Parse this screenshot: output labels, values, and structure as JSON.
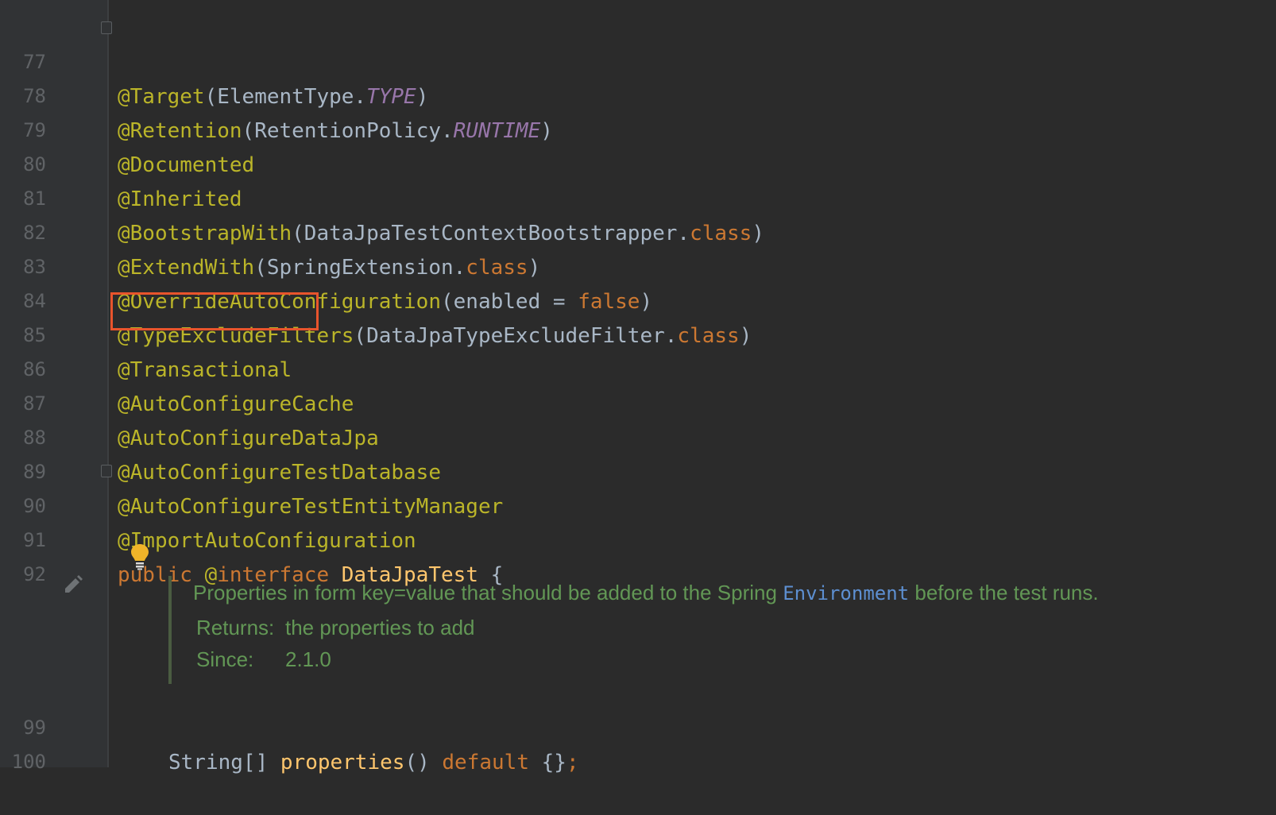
{
  "editor": {
    "lines": [
      {
        "num": "77",
        "a": "@Target",
        "b": "(ElementType.",
        "c": "TYPE",
        "d": ")"
      },
      {
        "num": "78",
        "a": "@Retention",
        "b": "(RetentionPolicy.",
        "c": "RUNTIME",
        "d": ")"
      },
      {
        "num": "79",
        "a": "@Documented"
      },
      {
        "num": "80",
        "a": "@Inherited"
      },
      {
        "num": "81",
        "a": "@BootstrapWith",
        "b": "(DataJpaTestContextBootstrapper.",
        "c": "class",
        "d": ")"
      },
      {
        "num": "82",
        "a": "@ExtendWith",
        "b": "(SpringExtension.",
        "c": "class",
        "d": ")"
      },
      {
        "num": "83",
        "a": "@OverrideAutoConfiguration",
        "b": "(enabled = ",
        "c": "false",
        "d": ")"
      },
      {
        "num": "84",
        "a": "@TypeExcludeFilters",
        "b": "(DataJpaTypeExcludeFilter.",
        "c": "class",
        "d": ")"
      },
      {
        "num": "85",
        "a": "@Transactional"
      },
      {
        "num": "86",
        "a": "@AutoConfigureCache"
      },
      {
        "num": "87",
        "a": "@AutoConfigureDataJpa"
      },
      {
        "num": "88",
        "a": "@AutoConfigureTestDatabase"
      },
      {
        "num": "89",
        "a": "@AutoConfigureTestEntityManager"
      },
      {
        "num": "90",
        "a": "@ImportAutoConfiguration"
      },
      {
        "num": "91",
        "a": "public",
        "b": "@",
        "c": "interface",
        "d": "DataJpaTest",
        "e": "{"
      },
      {
        "num": "92"
      },
      {
        "num": "99",
        "a": "String[]",
        "b": "properties",
        "c": "()",
        "d": "default",
        "e": "{}",
        "f": ";"
      },
      {
        "num": "100"
      }
    ],
    "doc": {
      "description_pre": "Properties in form key=value that should be added to the Spring ",
      "description_link": "Environment",
      "description_post": " before the test runs.",
      "returns_label": "Returns:",
      "returns_value": "the properties to add",
      "since_label": "Since:",
      "since_value": "2.1.0"
    },
    "highlighted_annotation": "@Transactional",
    "colors": {
      "background": "#2b2b2b",
      "gutter": "#313335",
      "annotation": "#bbb529",
      "keyword": "#cc7832",
      "constant": "#9876aa",
      "text": "#a9b7c6",
      "method": "#ffc66d",
      "doc": "#629755",
      "link": "#5d8fd1",
      "highlight_border": "#e8542c"
    },
    "icons": [
      "fold-marker-icon",
      "lightbulb-icon",
      "pencil-icon"
    ]
  }
}
